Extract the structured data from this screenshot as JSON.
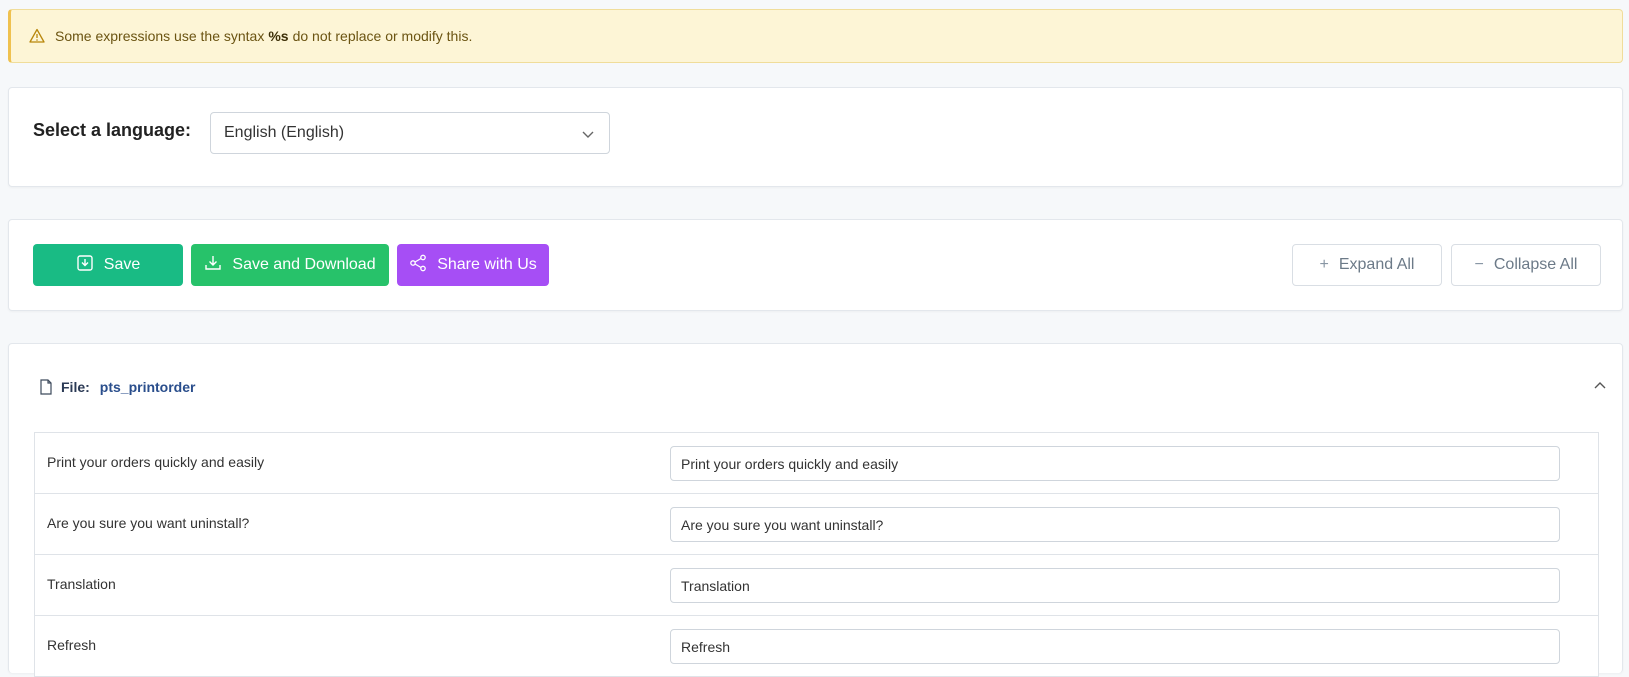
{
  "warning": {
    "prefix": "Some expressions use the syntax",
    "syntax": "%s",
    "suffix": "do not replace or modify this.",
    "icon": "warning-triangle-icon"
  },
  "language": {
    "label": "Select a language:",
    "selected": "English (English)"
  },
  "actions": {
    "save_label": "Save",
    "save_download_label": "Save and Download",
    "share_label": "Share with Us",
    "expand_label": "Expand All",
    "collapse_label": "Collapse All",
    "colors": {
      "save": "#19bb84",
      "save_download": "#27c26a",
      "share": "#a64ef5"
    }
  },
  "file": {
    "label": "File:",
    "name": "pts_printorder"
  },
  "rows": [
    {
      "source": "Print your orders quickly and easily",
      "translation": "Print your orders quickly and easily"
    },
    {
      "source": "Are you sure you want uninstall?",
      "translation": "Are you sure you want uninstall?"
    },
    {
      "source": "Translation",
      "translation": "Translation"
    },
    {
      "source": "Refresh",
      "translation": "Refresh"
    }
  ]
}
